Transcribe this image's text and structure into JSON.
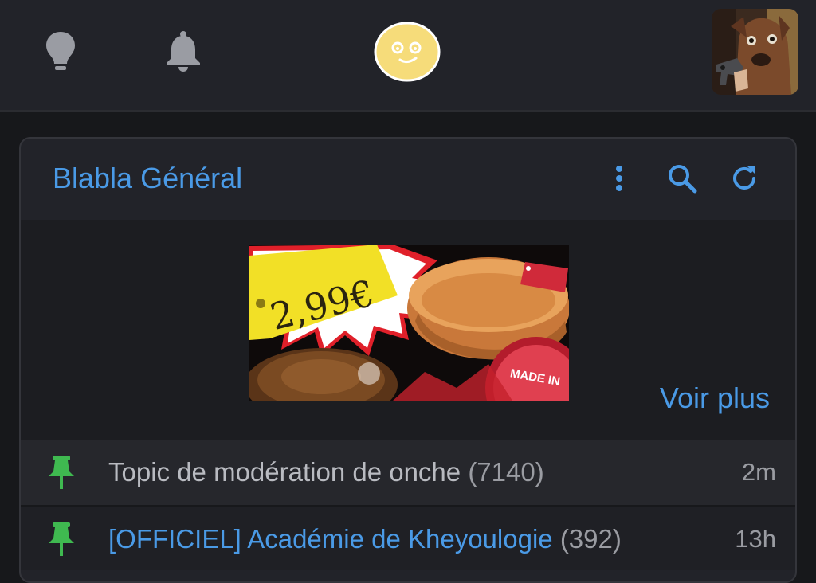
{
  "topbar": {
    "icons": [
      "lightbulb-icon",
      "bell-icon",
      "smiley-icon"
    ],
    "avatar_alt": "avatar"
  },
  "colors": {
    "accent": "#4a9ae6",
    "pin": "#3fb950",
    "background": "#17181b",
    "card": "#222329"
  },
  "forum": {
    "title": "Blabla Général",
    "actions": [
      "more-vertical-icon",
      "search-icon",
      "refresh-icon"
    ]
  },
  "banner": {
    "price": "2,99€",
    "made_in": "MADE IN",
    "voir_plus": "Voir plus"
  },
  "topics": [
    {
      "title": "Topic de modération de onche",
      "count": "(7140)",
      "age": "2m",
      "pinned": true
    },
    {
      "title": "[OFFICIEL] Académie de Kheyoulogie",
      "count": "(392)",
      "age": "13h",
      "pinned": true
    }
  ]
}
